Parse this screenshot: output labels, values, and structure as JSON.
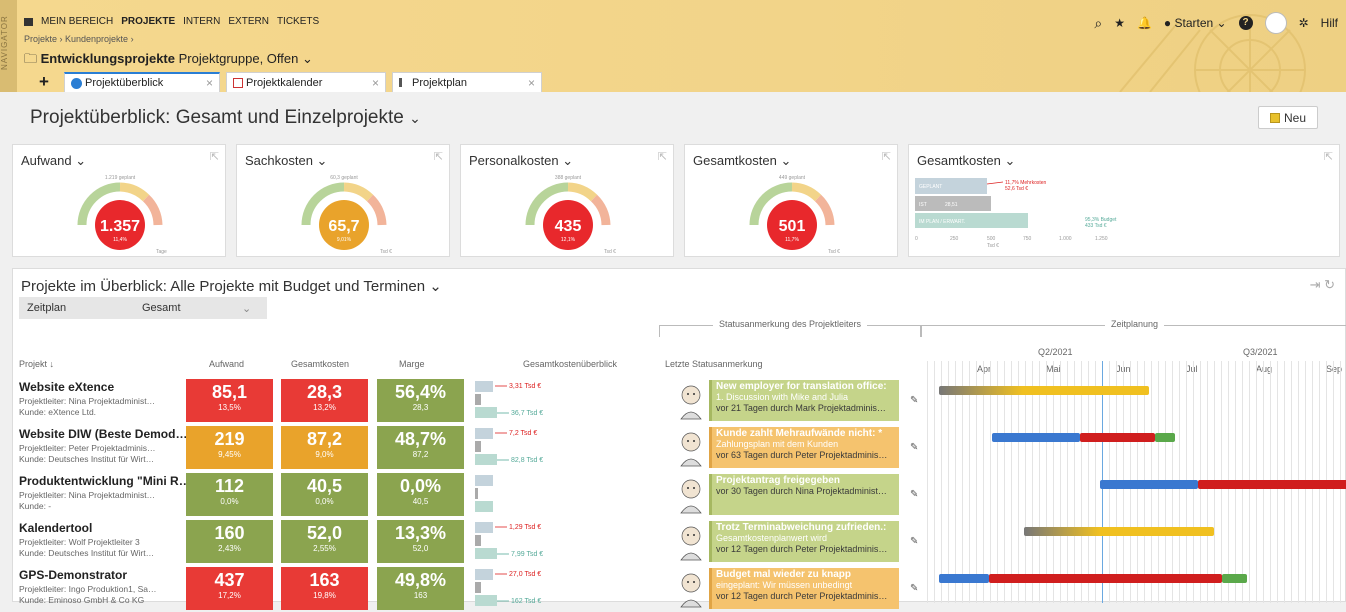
{
  "nav": {
    "vertical_label": "NAVIGATOR",
    "items": [
      "MEIN BEREICH",
      "PROJEKTE",
      "INTERN",
      "EXTERN",
      "TICKETS"
    ],
    "active": "PROJEKTE",
    "breadcrumb": "Projekte › Kundenprojekte ›",
    "group_title": "Entwicklungsprojekte",
    "group_sub": "Projektgruppe, Offen"
  },
  "tabs": [
    {
      "label": "Projektüberblick",
      "icon": "info-icon"
    },
    {
      "label": "Projektkalender",
      "icon": "calendar-icon"
    },
    {
      "label": "Projektplan",
      "icon": "plan-icon"
    }
  ],
  "top_right": {
    "start_label": "Starten",
    "help_label": "Hilf"
  },
  "page_title": "Projektüberblick: Gesamt und Einzelprojekte",
  "new_button": "Neu",
  "kpis": [
    {
      "title": "Aufwand",
      "value": "1.357",
      "sub": "11,4%",
      "top": "1.219 geplant",
      "unit": "Tage",
      "color": "#e8282c"
    },
    {
      "title": "Sachkosten",
      "value": "65,7",
      "sub": "9,01%",
      "top": "60,3 geplant",
      "unit": "Tsd €",
      "color": "#e9a32b"
    },
    {
      "title": "Personalkosten",
      "value": "435",
      "sub": "12,1%",
      "top": "388 geplant",
      "unit": "Tsd €",
      "color": "#e8282c"
    },
    {
      "title": "Gesamtkosten",
      "value": "501",
      "sub": "11,7%",
      "top": "449 geplant",
      "unit": "Tsd €",
      "color": "#e8282c"
    }
  ],
  "bar_kpi": {
    "title": "Gesamtkosten",
    "labels": [
      "GEPLANT",
      "IST",
      "IM PLAN / ERWART."
    ],
    "ist_value": "28,51",
    "note1": "11,7% Mehrkosten",
    "note1b": "52,6 Tsd €",
    "note2": "95,3% Budget",
    "note2b": "433 Tsd €",
    "axis": [
      "0",
      "250",
      "500",
      "750",
      "1.000",
      "1.250"
    ],
    "unit": "Tsd €"
  },
  "section": {
    "title": "Projekte im Überblick: Alle Projekte mit Budget und Terminen",
    "filter_label": "Zeitplan",
    "filter_value": "Gesamt",
    "group_status": "Statusanmerkung des Projektleiters",
    "group_zeit": "Zeitplanung",
    "headers": {
      "projekt": "Projekt ↓",
      "aufwand": "Aufwand",
      "gesamtkosten": "Gesamtkosten",
      "marge": "Marge",
      "ueberblick": "Gesamtkostenüberblick",
      "status": "Letzte Statusanmerkung"
    },
    "quarters": [
      "Q2/2021",
      "Q3/2021"
    ],
    "months": [
      "Apr",
      "Mai",
      "Jun",
      "Jul",
      "Aug",
      "Sep"
    ]
  },
  "projects": [
    {
      "name": "Website eXtence",
      "leiter": "Projektleiter:  Nina Projektadminist…",
      "kunde": "Kunde:  eXtence Ltd.",
      "aufwand": "85,1",
      "aufwand_s": "13,5%",
      "aufwand_c": "red",
      "kosten": "28,3",
      "kosten_s": "13,2%",
      "kosten_c": "red",
      "marge": "56,4%",
      "marge_s": "28,3",
      "marge_c": "grn",
      "mini_top": "3,31 Tsd €",
      "mini_bot": "36,7 Tsd €",
      "note_title": "New employer for translation office:",
      "note_text": "1. Discussion with Mike and Julia",
      "note_date": "vor 21 Tagen durch Mark Projektadminis…",
      "note_color": "g"
    },
    {
      "name": "Website DIW (Beste Demod…",
      "leiter": "Projektleiter:  Peter Projektadminis…",
      "kunde": "Kunde:  Deutsches Institut für Wirt…",
      "aufwand": "219",
      "aufwand_s": "9,45%",
      "aufwand_c": "org",
      "kosten": "87,2",
      "kosten_s": "9,0%",
      "kosten_c": "org",
      "marge": "48,7%",
      "marge_s": "87,2",
      "marge_c": "grn",
      "mini_top": "7,2 Tsd €",
      "mini_bot": "82,8 Tsd €",
      "note_title": "Kunde zahlt Mehraufwände nicht: *",
      "note_text": "Zahlungsplan mit dem Kunden",
      "note_date": "vor 63 Tagen durch Peter Projektadminis…",
      "note_color": "o"
    },
    {
      "name": "Produktentwicklung \"Mini R…",
      "leiter": "Projektleiter:  Nina Projektadminist…",
      "kunde": "Kunde:  -",
      "aufwand": "112",
      "aufwand_s": "0,0%",
      "aufwand_c": "grn",
      "kosten": "40,5",
      "kosten_s": "0,0%",
      "kosten_c": "grn",
      "marge": "0,0%",
      "marge_s": "40,5",
      "marge_c": "grn",
      "mini_top": "",
      "mini_bot": "",
      "note_title": "Projektantrag freigegeben",
      "note_text": "",
      "note_date": "vor 30 Tagen durch Nina Projektadminist…",
      "note_color": "g"
    },
    {
      "name": "Kalendertool",
      "leiter": "Projektleiter:  Wolf Projektleiter 3",
      "kunde": "Kunde:  Deutsches Institut für Wirt…",
      "aufwand": "160",
      "aufwand_s": "2,43%",
      "aufwand_c": "grn",
      "kosten": "52,0",
      "kosten_s": "2,55%",
      "kosten_c": "grn",
      "marge": "13,3%",
      "marge_s": "52,0",
      "marge_c": "grn",
      "mini_top": "1,29 Tsd €",
      "mini_bot": "7,99 Tsd €",
      "note_title": "Trotz Terminabweichung zufrieden.:",
      "note_text": "Gesamtkostenplanwert wird",
      "note_date": "vor 12 Tagen durch Peter Projektadminis…",
      "note_color": "g"
    },
    {
      "name": "GPS-Demonstrator",
      "leiter": "Projektleiter:  Ingo Produktion1, Sa…",
      "kunde": "Kunde:  Eminoso GmbH & Co KG",
      "aufwand": "437",
      "aufwand_s": "17,2%",
      "aufwand_c": "red",
      "kosten": "163",
      "kosten_s": "19,8%",
      "kosten_c": "red",
      "marge": "49,8%",
      "marge_s": "163",
      "marge_c": "grn",
      "mini_top": "27,0 Tsd €",
      "mini_bot": "162 Tsd €",
      "note_title": "Budget mal wieder zu knapp",
      "note_text": "eingeplant: Wir müssen unbedingt",
      "note_date": "vor 12 Tagen durch Peter Projektadminis…",
      "note_color": "o"
    }
  ]
}
